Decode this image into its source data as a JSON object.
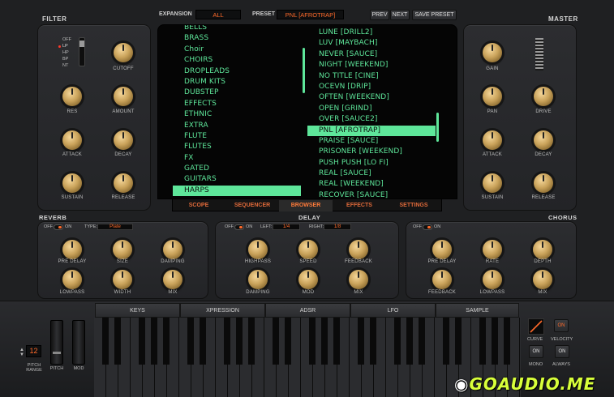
{
  "header": {
    "expansion_label": "EXPANSION",
    "expansion_value": "ALL",
    "preset_label": "PRESET",
    "preset_value": "PNL [AFROTRAP]",
    "prev": "PREV",
    "next": "NEXT",
    "save": "SAVE PRESET"
  },
  "filter": {
    "title": "FILTER",
    "modes": [
      "OFF",
      "LP",
      "HP",
      "BP",
      "NT"
    ],
    "knobs": [
      "CUTOFF",
      "RES",
      "AMOUNT",
      "ATTACK",
      "DECAY",
      "SUSTAIN",
      "RELEASE"
    ]
  },
  "master": {
    "title": "MASTER",
    "knobs": [
      "GAIN",
      "PAN",
      "DRIVE",
      "ATTACK",
      "DECAY",
      "SUSTAIN",
      "RELEASE"
    ]
  },
  "browser": {
    "categories": [
      "BELLS",
      "BRASS",
      "Choir",
      "CHOIRS",
      "DROPLEADS",
      "DRUM KITS",
      "DUBSTEP",
      "EFFECTS",
      "ETHNIC",
      "EXTRA",
      "FLUTE",
      "FLUTES",
      "FX",
      "GATED",
      "GUITARS",
      "HARPS"
    ],
    "selected_category": "HARPS",
    "presets": [
      "LUNE [DRILL2]",
      "LUV [MAYBACH]",
      "NEVER [SAUCE]",
      "NIGHT [WEEKEND]",
      "NO TITLE [CINE]",
      "OCEVN [DRIP]",
      "OFTEN [WEEKEND]",
      "OPEN [GRIND]",
      "OVER [SAUCE2]",
      "PNL [AFROTRAP]",
      "PRAISE [SAUCE]",
      "PRISONER [WEEKEND]",
      "PUSH PUSH [LO FI]",
      "REAL [SAUCE]",
      "REAL [WEEKEND]",
      "RECOVER [SAUCE]"
    ],
    "selected_preset": "PNL [AFROTRAP]"
  },
  "tabs": [
    "SCOPE",
    "SEQUENCER",
    "BROWSER",
    "EFFECTS",
    "SETTINGS"
  ],
  "active_tab": "BROWSER",
  "reverb": {
    "title": "REVERB",
    "off": "OFF",
    "on": "ON",
    "type_label": "TYPE:",
    "type_value": "Plate",
    "knobs": [
      "PRE DELAY",
      "SIZE",
      "DAMPING",
      "LOWPASS",
      "WIDTH",
      "MIX"
    ]
  },
  "delay": {
    "title": "DELAY",
    "off": "OFF",
    "on": "ON",
    "left_label": "LEFT:",
    "left_value": "1/4",
    "right_label": "RIGHT:",
    "right_value": "1/8",
    "knobs": [
      "HIGHPASS",
      "SPEED",
      "FEEDBACK",
      "DAMPING",
      "MOD",
      "MIX"
    ]
  },
  "chorus": {
    "title": "CHORUS",
    "off": "OFF",
    "on": "ON",
    "knobs": [
      "PRE DELAY",
      "RATE",
      "DEPTH",
      "FEEDBACK",
      "LOWPASS",
      "MIX"
    ]
  },
  "lower_tabs": [
    "KEYS",
    "XPRESSION",
    "ADSR",
    "LFO",
    "SAMPLE"
  ],
  "left": {
    "pitch_range_value": "12",
    "pitch_range_label": "PITCH\nRANGE",
    "pitch_label": "PITCH",
    "mod_label": "MOD"
  },
  "right": {
    "curve": "CURVE",
    "velocity_toggle": "ON",
    "velocity": "VELOCITY",
    "mono_toggle": "ON",
    "mono": "MONO",
    "always_toggle": "ON",
    "always": "ALWAYS"
  },
  "watermark": "GOAUDIO.ME",
  "colors": {
    "accent": "#ff6a2a",
    "list_green": "#5ee69a",
    "knob_gold": "#c9a25a"
  }
}
